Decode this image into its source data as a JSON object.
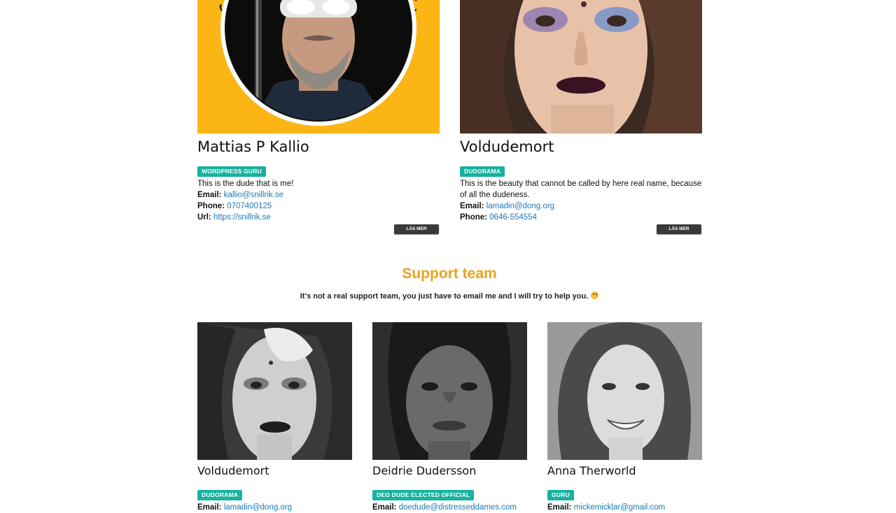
{
  "team": [
    {
      "name": "Mattias P Kallio",
      "role": "WORDPRESS GURU",
      "text": "This is the dude that is me!",
      "email_label": "Email:",
      "email": "kallio@snillrik.se",
      "phone_label": "Phone:",
      "phone": "0707400125",
      "url_label": "Url:",
      "url": "https://snillrik.se",
      "button": "LÄS MER",
      "ring_text": "SNILLRIK - SNILLRIK -"
    },
    {
      "name": "Voldudemort",
      "role": "DUDORAMA",
      "text": "This is the beauty that cannot be called by here real name, because of all the dudeness.",
      "email_label": "Email:",
      "email": "lamadin@dong.org",
      "phone_label": "Phone:",
      "phone": "0646-554554",
      "button": "LÄS MER"
    }
  ],
  "support": {
    "title": "Support team",
    "subtitle": "It's not a real support team, you just have to email me and I will try to help you.",
    "members": [
      {
        "name": "Voldudemort",
        "role": "DUDORAMA",
        "email_label": "Email:",
        "email": "lamadin@dong.org"
      },
      {
        "name": "Deidrie Dudersson",
        "role": "DEO DUDE ELECTED OFFICIAL",
        "email_label": "Email:",
        "email": "doedude@distresseddames.com"
      },
      {
        "name": "Anna Therworld",
        "role": "GURU",
        "email_label": "Email:",
        "email": "mickemicklar@gmail.com"
      }
    ]
  },
  "colors": {
    "accent": "#eba21e",
    "badge": "#17b2a0",
    "link": "#1a79b3",
    "button": "#3a3a3a",
    "logo_bg": "#fbb616"
  }
}
